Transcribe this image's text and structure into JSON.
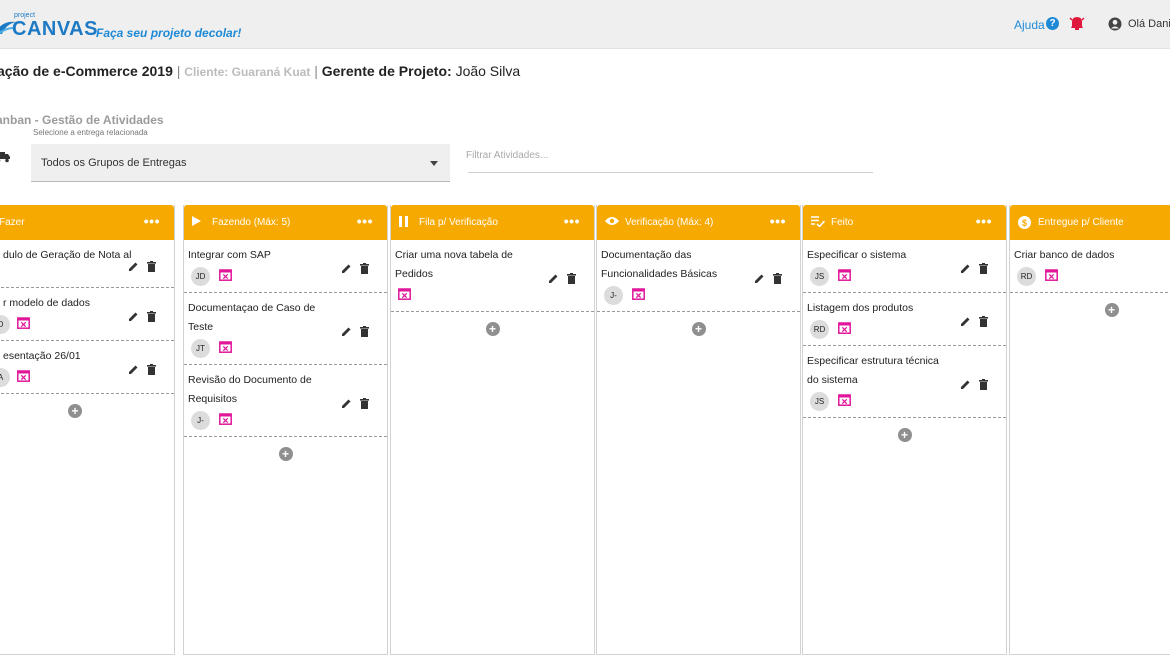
{
  "header": {
    "logo_small": "project",
    "logo_main": "CANVAS",
    "tagline": "Faça seu projeto decolar!",
    "help_label": "Ajuda",
    "greeting": "Olá Dani",
    "accent_color": "#1e8ad6"
  },
  "project": {
    "name": "ação de e-Commerce 2019",
    "client_label": "Cliente: Guaraná Kuat",
    "manager_label": "Gerente de Projeto:",
    "manager_name": "João Silva"
  },
  "kanban": {
    "title": "anban - Gestão de Atividades",
    "select_hint": "Selecione a entrega relacionada",
    "selected_group": "Todos os Grupos de Entregas",
    "filter_placeholder": "Filtrar Atividades...",
    "column_color": "#f6a900"
  },
  "columns": [
    {
      "title": "Fazer",
      "icon": "list-icon",
      "cards": [
        {
          "title": "dulo de Geração de Nota al",
          "initials": ""
        },
        {
          "title": "r modelo de dados",
          "initials": "D"
        },
        {
          "title": "esentação 26/01",
          "initials": "A"
        }
      ]
    },
    {
      "title": "Fazendo (Máx: 5)",
      "icon": "play-icon",
      "cards": [
        {
          "title": "Integrar com SAP",
          "initials": "JD"
        },
        {
          "title": "Documentaçao de Caso de Teste",
          "initials": "JT"
        },
        {
          "title": "Revisão do Documento de Requisitos",
          "initials": "J-"
        }
      ]
    },
    {
      "title": "Fila p/ Verificação",
      "icon": "pause-icon",
      "cards": [
        {
          "title": "Criar uma nova tabela de Pedidos",
          "initials": ""
        }
      ]
    },
    {
      "title": "Verificação (Máx: 4)",
      "icon": "eye-icon",
      "cards": [
        {
          "title": "Documentação das Funcionalidades Básicas",
          "initials": "J-"
        }
      ]
    },
    {
      "title": "Feito",
      "icon": "done-list-icon",
      "cards": [
        {
          "title": "Especificar o sistema",
          "initials": "JS"
        },
        {
          "title": "Listagem dos produtos",
          "initials": "RD"
        },
        {
          "title": "Especificar estrutura técnica do sistema",
          "initials": "JS"
        }
      ]
    },
    {
      "title": "Entregue p/ Cliente",
      "icon": "dollar-icon",
      "cards": [
        {
          "title": "Criar banco de dados",
          "initials": "RD"
        }
      ]
    }
  ]
}
